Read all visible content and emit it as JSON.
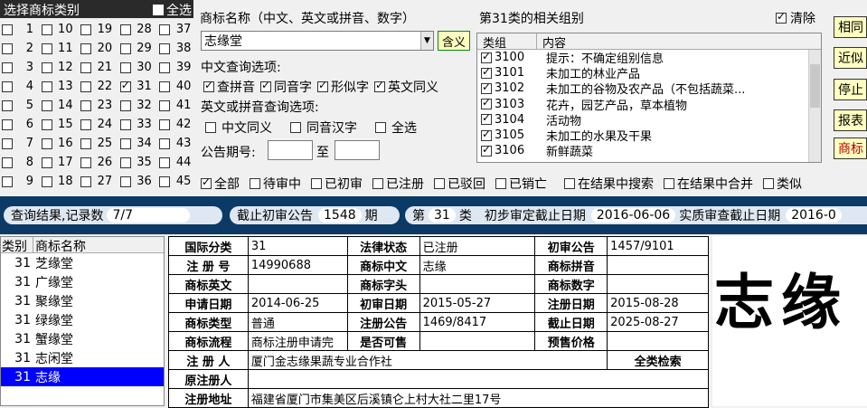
{
  "class_panel": {
    "title": "选择商标类别",
    "select_all": "全选",
    "rows": [
      [
        {
          "n": "1",
          "on": false
        },
        {
          "n": "10",
          "on": false
        },
        {
          "n": "19",
          "on": false
        },
        {
          "n": "28",
          "on": false
        },
        {
          "n": "37",
          "on": false
        }
      ],
      [
        {
          "n": "2",
          "on": false
        },
        {
          "n": "11",
          "on": false
        },
        {
          "n": "20",
          "on": false
        },
        {
          "n": "29",
          "on": false
        },
        {
          "n": "38",
          "on": false
        }
      ],
      [
        {
          "n": "3",
          "on": false
        },
        {
          "n": "12",
          "on": false
        },
        {
          "n": "21",
          "on": false
        },
        {
          "n": "30",
          "on": false
        },
        {
          "n": "39",
          "on": false
        }
      ],
      [
        {
          "n": "4",
          "on": false
        },
        {
          "n": "13",
          "on": false
        },
        {
          "n": "22",
          "on": false
        },
        {
          "n": "31",
          "on": true
        },
        {
          "n": "40",
          "on": false
        }
      ],
      [
        {
          "n": "5",
          "on": false
        },
        {
          "n": "14",
          "on": false
        },
        {
          "n": "23",
          "on": false
        },
        {
          "n": "32",
          "on": false
        },
        {
          "n": "41",
          "on": false
        }
      ],
      [
        {
          "n": "6",
          "on": false
        },
        {
          "n": "15",
          "on": false
        },
        {
          "n": "24",
          "on": false
        },
        {
          "n": "33",
          "on": false
        },
        {
          "n": "42",
          "on": false
        }
      ],
      [
        {
          "n": "7",
          "on": false
        },
        {
          "n": "16",
          "on": false
        },
        {
          "n": "25",
          "on": false
        },
        {
          "n": "34",
          "on": false
        },
        {
          "n": "43",
          "on": false
        }
      ],
      [
        {
          "n": "8",
          "on": false
        },
        {
          "n": "17",
          "on": false
        },
        {
          "n": "26",
          "on": false
        },
        {
          "n": "35",
          "on": false
        },
        {
          "n": "44",
          "on": false
        }
      ],
      [
        {
          "n": "9",
          "on": false
        },
        {
          "n": "18",
          "on": false
        },
        {
          "n": "27",
          "on": false
        },
        {
          "n": "36",
          "on": false
        },
        {
          "n": "45",
          "on": false
        }
      ]
    ]
  },
  "tm": {
    "name_label": "商标名称（中文、英文或拼音、数字）",
    "name_value": "志缘堂",
    "contains_btn": "含义",
    "cn_options_label": "中文查询选项:",
    "cn_options": [
      "查拼音",
      "同音字",
      "形似字",
      "英文同义"
    ],
    "en_options_label": "英文或拼音查询选项:",
    "en_options": [
      "中文同义",
      "同音汉字",
      "全选"
    ],
    "pub_label": "公告期号:",
    "pub_to": "至"
  },
  "groups": {
    "title": "第31类的相关组别",
    "clear": "清除",
    "col1": "类组",
    "col2": "内容",
    "rows": [
      {
        "code": "3100",
        "text": "提示：不确定组别信息"
      },
      {
        "code": "3101",
        "text": "未加工的林业产品"
      },
      {
        "code": "3102",
        "text": "未加工的谷物及农产品（不包括蔬菜..."
      },
      {
        "code": "3103",
        "text": "花卉，园艺产品，草本植物"
      },
      {
        "code": "3104",
        "text": "活动物"
      },
      {
        "code": "3105",
        "text": "未加工的水果及干果"
      },
      {
        "code": "3106",
        "text": "新鲜蔬菜"
      }
    ]
  },
  "side_buttons": [
    {
      "label": "相同",
      "bg": "#ffffc0",
      "color": "#000"
    },
    {
      "label": "近似",
      "bg": "#ffffc0",
      "color": "#000"
    },
    {
      "label": "停止",
      "bg": "#ffffc0",
      "color": "#000"
    },
    {
      "label": "报表",
      "bg": "#ffffc0",
      "color": "#000"
    },
    {
      "label": "商标",
      "bg": "#ffffc0",
      "color": "#c00000"
    }
  ],
  "status_filters": [
    {
      "label": "全部",
      "on": true
    },
    {
      "label": "待审中",
      "on": false
    },
    {
      "label": "已初审",
      "on": false
    },
    {
      "label": "已注册",
      "on": false
    },
    {
      "label": "已驳回",
      "on": false
    },
    {
      "label": "已销亡",
      "on": false
    },
    {
      "label": "在结果中搜索",
      "on": false
    },
    {
      "label": "在结果中合并",
      "on": false
    },
    {
      "label": "类似",
      "on": false
    }
  ],
  "info_bar": {
    "result_label": "查询结果,记录数",
    "result_value": "7/7",
    "cutoff_label": "截止初审公告",
    "cutoff_value": "1548",
    "cutoff_suffix": "期",
    "class_prefix": "第",
    "class_value": "31",
    "class_suffix": "类",
    "prelim_label": "初步审定截止日期",
    "prelim_value": "2016-06-06",
    "subst_label": "实质审查截止日期",
    "subst_value": "2016-0"
  },
  "results": {
    "col1": "类别",
    "col2": "商标名称",
    "rows": [
      {
        "cls": "31",
        "name": "芝缘堂",
        "sel": false
      },
      {
        "cls": "31",
        "name": "广缘堂",
        "sel": false
      },
      {
        "cls": "31",
        "name": "聚缘堂",
        "sel": false
      },
      {
        "cls": "31",
        "name": "绿缘堂",
        "sel": false
      },
      {
        "cls": "31",
        "name": "蟹缘堂",
        "sel": false
      },
      {
        "cls": "31",
        "name": "志闲堂",
        "sel": false
      },
      {
        "cls": "31",
        "name": "志缘",
        "sel": true
      }
    ]
  },
  "detail": {
    "intl_class_h": "国际分类",
    "intl_class": "31",
    "legal_h": "法律状态",
    "legal": "已注册",
    "prelim_h": "初审公告",
    "prelim": "1457/9101",
    "regno_h": "注 册 号",
    "regno": "14990688",
    "cn_h": "商标中文",
    "cn": "志缘",
    "pinyin_h": "商标拼音",
    "pinyin": "",
    "en_h": "商标英文",
    "en": "",
    "head_h": "商标字头",
    "head": "",
    "num_h": "商标数字",
    "num": "",
    "apply_h": "申请日期",
    "apply": "2014-06-25",
    "prelim_date_h": "初审日期",
    "prelim_date": "2015-05-27",
    "reg_date_h": "注册日期",
    "reg_date": "2015-08-28",
    "type_h": "商标类型",
    "type": "普通",
    "reg_pub_h": "注册公告",
    "reg_pub": "1469/8417",
    "expiry_h": "截止日期",
    "expiry": "2025-08-27",
    "flow_h": "商标流程",
    "flow": "商标注册申请完",
    "sellable_h": "是否可售",
    "sellable": "",
    "presale_h": "预售价格",
    "presale": "",
    "registrant_h": "注 册 人",
    "registrant": "厦门金志缘果蔬专业合作社",
    "search_all": "全类检索",
    "orig_h": "原注册人",
    "orig": "",
    "addr_h": "注册地址",
    "addr": "福建省厦门市集美区后溪镇仑上村大社二里17号"
  },
  "logo": {
    "text": "志缘"
  }
}
